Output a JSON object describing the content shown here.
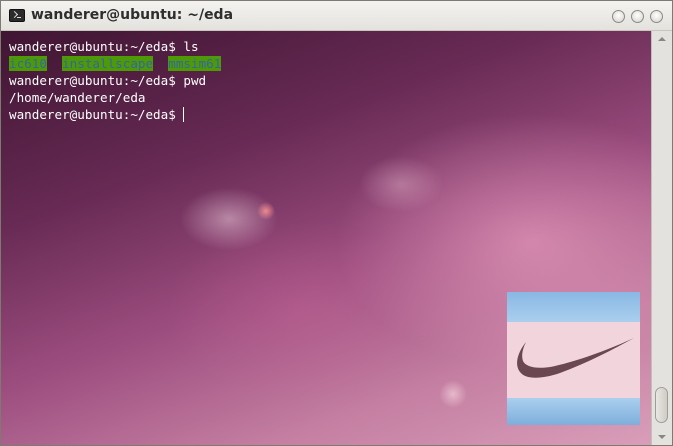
{
  "window": {
    "title": "wanderer@ubuntu: ~/eda"
  },
  "terminal": {
    "lines": [
      {
        "prompt": "wanderer@ubuntu:~/eda$ ",
        "command": "ls"
      },
      {
        "prompt": "wanderer@ubuntu:~/eda$ ",
        "command": "pwd"
      },
      {
        "prompt": "wanderer@ubuntu:~/eda$ ",
        "command": ""
      }
    ],
    "ls_output": [
      "ic610",
      "installscape",
      "mmsim61"
    ],
    "pwd_output": "/home/wanderer/eda",
    "colors": {
      "text": "#ffffff",
      "directory_bg": "#4e9a06",
      "directory_fg": "#3465a4"
    }
  },
  "overlay_image": {
    "icon": "nike-swoosh-logo",
    "colors": {
      "band": "#89b7e3",
      "middle": "#f2d5dc",
      "swoosh": "#6b4752"
    }
  }
}
